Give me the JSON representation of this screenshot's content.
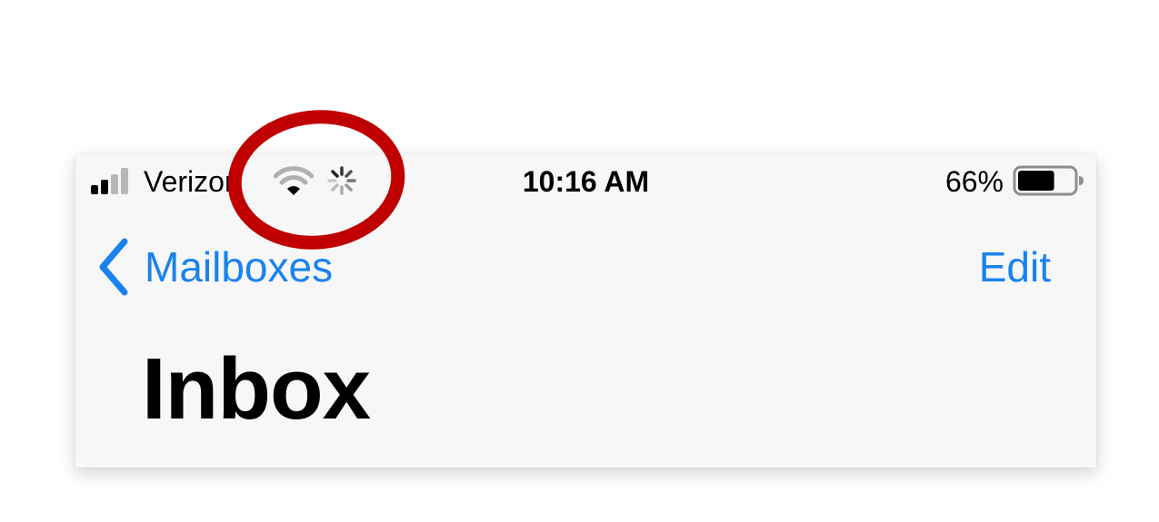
{
  "status_bar": {
    "carrier": "Verizon",
    "time": "10:16 AM",
    "battery_percent": "66%",
    "battery_level": 0.66,
    "signal_bars_active": 2,
    "signal_bars_total": 4,
    "icons": [
      "signal-icon",
      "wifi-icon",
      "activity-spinner-icon",
      "battery-icon"
    ]
  },
  "nav_bar": {
    "back_label": "Mailboxes",
    "edit_label": "Edit"
  },
  "title": "Inbox",
  "colors": {
    "accent": "#1a82ee",
    "annotation": "#c00000",
    "bar_background": "#f7f7f7"
  }
}
